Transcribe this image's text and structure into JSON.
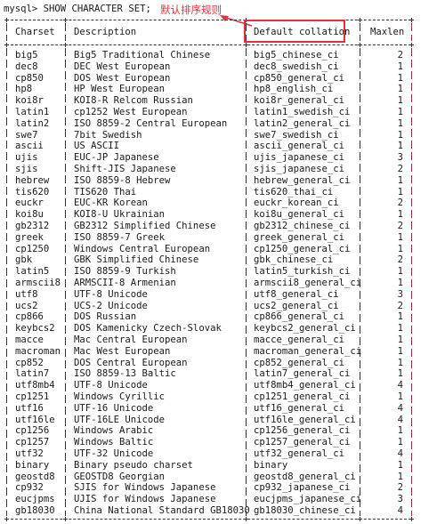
{
  "terminal": {
    "prompt": "mysql> SHOW CHARACTER SET;"
  },
  "annotation": {
    "text": "默认排序规则",
    "color": "#e8303c",
    "target": "Default collation"
  },
  "table": {
    "headers": [
      "Charset",
      "Description",
      "Default collation",
      "Maxlen"
    ],
    "rows": [
      [
        "big5",
        "Big5 Traditional Chinese",
        "big5_chinese_ci",
        "2"
      ],
      [
        "dec8",
        "DEC West European",
        "dec8_swedish_ci",
        "1"
      ],
      [
        "cp850",
        "DOS West European",
        "cp850_general_ci",
        "1"
      ],
      [
        "hp8",
        "HP West European",
        "hp8_english_ci",
        "1"
      ],
      [
        "koi8r",
        "KOI8-R Relcom Russian",
        "koi8r_general_ci",
        "1"
      ],
      [
        "latin1",
        "cp1252 West European",
        "latin1_swedish_ci",
        "1"
      ],
      [
        "latin2",
        "ISO 8859-2 Central European",
        "latin2_general_ci",
        "1"
      ],
      [
        "swe7",
        "7bit Swedish",
        "swe7_swedish_ci",
        "1"
      ],
      [
        "ascii",
        "US ASCII",
        "ascii_general_ci",
        "1"
      ],
      [
        "ujis",
        "EUC-JP Japanese",
        "ujis_japanese_ci",
        "3"
      ],
      [
        "sjis",
        "Shift-JIS Japanese",
        "sjis_japanese_ci",
        "2"
      ],
      [
        "hebrew",
        "ISO 8859-8 Hebrew",
        "hebrew_general_ci",
        "1"
      ],
      [
        "tis620",
        "TIS620 Thai",
        "tis620_thai_ci",
        "1"
      ],
      [
        "euckr",
        "EUC-KR Korean",
        "euckr_korean_ci",
        "2"
      ],
      [
        "koi8u",
        "KOI8-U Ukrainian",
        "koi8u_general_ci",
        "1"
      ],
      [
        "gb2312",
        "GB2312 Simplified Chinese",
        "gb2312_chinese_ci",
        "2"
      ],
      [
        "greek",
        "ISO 8859-7 Greek",
        "greek_general_ci",
        "1"
      ],
      [
        "cp1250",
        "Windows Central European",
        "cp1250_general_ci",
        "1"
      ],
      [
        "gbk",
        "GBK Simplified Chinese",
        "gbk_chinese_ci",
        "2"
      ],
      [
        "latin5",
        "ISO 8859-9 Turkish",
        "latin5_turkish_ci",
        "1"
      ],
      [
        "armscii8",
        "ARMSCII-8 Armenian",
        "armscii8_general_ci",
        "1"
      ],
      [
        "utf8",
        "UTF-8 Unicode",
        "utf8_general_ci",
        "3"
      ],
      [
        "ucs2",
        "UCS-2 Unicode",
        "ucs2_general_ci",
        "2"
      ],
      [
        "cp866",
        "DOS Russian",
        "cp866_general_ci",
        "1"
      ],
      [
        "keybcs2",
        "DOS Kamenicky Czech-Slovak",
        "keybcs2_general_ci",
        "1"
      ],
      [
        "macce",
        "Mac Central European",
        "macce_general_ci",
        "1"
      ],
      [
        "macroman",
        "Mac West European",
        "macroman_general_ci",
        "1"
      ],
      [
        "cp852",
        "DOS Central European",
        "cp852_general_ci",
        "1"
      ],
      [
        "latin7",
        "ISO 8859-13 Baltic",
        "latin7_general_ci",
        "1"
      ],
      [
        "utf8mb4",
        "UTF-8 Unicode",
        "utf8mb4_general_ci",
        "4"
      ],
      [
        "cp1251",
        "Windows Cyrillic",
        "cp1251_general_ci",
        "1"
      ],
      [
        "utf16",
        "UTF-16 Unicode",
        "utf16_general_ci",
        "4"
      ],
      [
        "utf16le",
        "UTF-16LE Unicode",
        "utf16le_general_ci",
        "4"
      ],
      [
        "cp1256",
        "Windows Arabic",
        "cp1256_general_ci",
        "1"
      ],
      [
        "cp1257",
        "Windows Baltic",
        "cp1257_general_ci",
        "1"
      ],
      [
        "utf32",
        "UTF-32 Unicode",
        "utf32_general_ci",
        "4"
      ],
      [
        "binary",
        "Binary pseudo charset",
        "binary",
        "1"
      ],
      [
        "geostd8",
        "GEOSTD8 Georgian",
        "geostd8_general_ci",
        "1"
      ],
      [
        "cp932",
        "SJIS for Windows Japanese",
        "cp932_japanese_ci",
        "2"
      ],
      [
        "eucjpms",
        "UJIS for Windows Japanese",
        "eucjpms_japanese_ci",
        "3"
      ],
      [
        "gb18030",
        "China National Standard GB18030",
        "gb18030_chinese_ci",
        "4"
      ]
    ]
  }
}
